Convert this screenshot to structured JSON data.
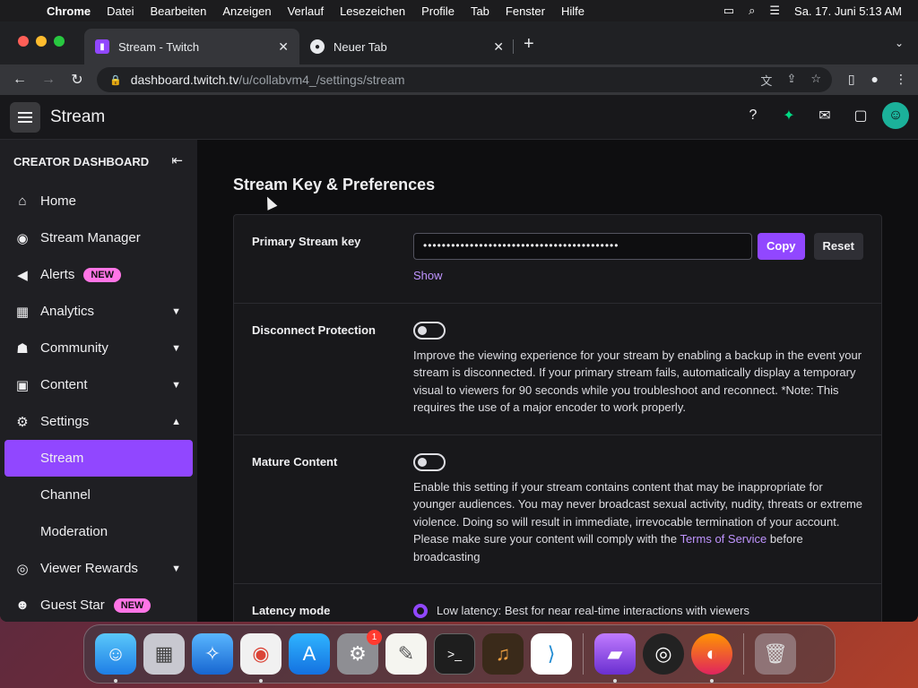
{
  "menubar": {
    "items": [
      "Chrome",
      "Datei",
      "Bearbeiten",
      "Anzeigen",
      "Verlauf",
      "Lesezeichen",
      "Profile",
      "Tab",
      "Fenster",
      "Hilfe"
    ],
    "clock": "Sa. 17. Juni  5:13 AM"
  },
  "browser": {
    "tabs": [
      {
        "title": "Stream - Twitch",
        "favicon": "twitch-icon",
        "active": true
      },
      {
        "title": "Neuer Tab",
        "favicon": "chrome-icon",
        "active": false
      }
    ],
    "url_host": "dashboard.twitch.tv",
    "url_path": "/u/collabvm4_/settings/stream"
  },
  "header": {
    "title": "Stream"
  },
  "sidebar": {
    "title": "CREATOR DASHBOARD",
    "items": [
      {
        "label": "Home",
        "icon": "home-icon"
      },
      {
        "label": "Stream Manager",
        "icon": "broadcast-icon"
      },
      {
        "label": "Alerts",
        "icon": "megaphone-icon",
        "badge": "NEW"
      },
      {
        "label": "Analytics",
        "icon": "chart-icon",
        "expandable": true
      },
      {
        "label": "Community",
        "icon": "people-icon",
        "expandable": true
      },
      {
        "label": "Content",
        "icon": "content-icon",
        "expandable": true
      },
      {
        "label": "Settings",
        "icon": "gear-icon",
        "expanded": true
      },
      {
        "label": "Stream",
        "sub": true,
        "active": true
      },
      {
        "label": "Channel",
        "sub": true
      },
      {
        "label": "Moderation",
        "sub": true
      },
      {
        "label": "Viewer Rewards",
        "icon": "reward-icon",
        "expandable": true
      },
      {
        "label": "Guest Star",
        "icon": "guest-icon",
        "badge": "NEW"
      }
    ]
  },
  "main": {
    "section_title": "Stream Key & Preferences",
    "primary_key": {
      "label": "Primary Stream key",
      "masked_value": "••••••••••••••••••••••••••••••••••••••••••",
      "copy_label": "Copy",
      "reset_label": "Reset",
      "show_label": "Show"
    },
    "disconnect": {
      "label": "Disconnect Protection",
      "enabled": false,
      "description": "Improve the viewing experience for your stream by enabling a backup in the event your stream is disconnected. If your primary stream fails, automatically display a temporary visual to viewers for 90 seconds while you troubleshoot and reconnect. *Note: This requires the use of a major encoder to work properly."
    },
    "mature": {
      "label": "Mature Content",
      "enabled": false,
      "description_pre": "Enable this setting if your stream contains content that may be inappropriate for younger audiences. You may never broadcast sexual activity, nudity, threats or extreme violence. Doing so will result in immediate, irrevocable termination of your account. Please make sure your content will comply with the ",
      "link_text": "Terms of Service",
      "description_post": " before broadcasting"
    },
    "latency": {
      "label": "Latency mode",
      "option_low": "Low latency: Best for near real-time interactions with viewers"
    }
  },
  "dock": {
    "apps": [
      "finder-icon",
      "launchpad-icon",
      "safari-icon",
      "chrome-icon",
      "appstore-icon",
      "system-settings-icon",
      "textedit-icon",
      "terminal-icon",
      "garageband-icon",
      "vscode-icon",
      "podcast-icon",
      "obs-icon",
      "firefox-icon",
      "trash-icon"
    ],
    "settings_badge": "1"
  },
  "colors": {
    "accent": "#9147ff",
    "badge": "#ff75e6",
    "link": "#bf94ff"
  }
}
